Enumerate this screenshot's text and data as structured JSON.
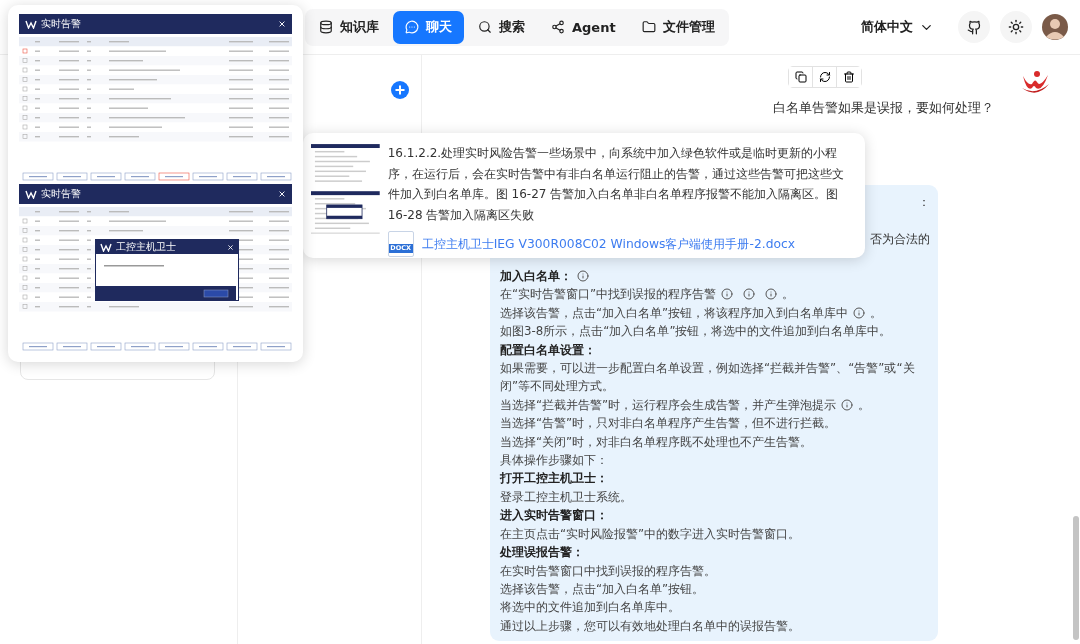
{
  "nav": {
    "tabs": [
      {
        "label": "知识库",
        "selected": false
      },
      {
        "label": "聊天",
        "selected": true
      },
      {
        "label": "搜索",
        "selected": false
      },
      {
        "label": "Agent",
        "selected": false
      },
      {
        "label": "文件管理",
        "selected": false
      }
    ],
    "language": "简体中文"
  },
  "preview": {
    "screens": [
      {
        "title": "实时告警"
      },
      {
        "title": "实时告警",
        "dialog": {
          "title": "工控主机卫士"
        }
      }
    ]
  },
  "chat": {
    "user_message": "白名单告警如果是误报，要如何处理？",
    "answer": {
      "fragments": [
        "：",
        "否为合法的"
      ],
      "lines": [
        {
          "bold": true,
          "segments": [
            {
              "kind": "text",
              "text": "加入白名单："
            },
            {
              "kind": "info"
            }
          ]
        },
        {
          "bold": false,
          "segments": [
            {
              "kind": "text",
              "text": "在“实时告警窗口”中找到误报的程序告警"
            },
            {
              "kind": "info"
            },
            {
              "kind": "info"
            },
            {
              "kind": "info"
            },
            {
              "kind": "text",
              "text": "。"
            }
          ]
        },
        {
          "bold": false,
          "segments": [
            {
              "kind": "text",
              "text": "选择该告警，点击“加入白名单”按钮，将该程序加入到白名单库中"
            },
            {
              "kind": "info"
            },
            {
              "kind": "text",
              "text": "。"
            }
          ]
        },
        {
          "bold": false,
          "text": "如图3-8所示，点击“加入白名单”按钮，将选中的文件追加到白名单库中。"
        },
        {
          "bold": true,
          "text": "配置白名单设置："
        },
        {
          "bold": false,
          "text": "如果需要，可以进一步配置白名单设置，例如选择“拦截并告警”、“告警”或“关闭”等不同处理方式。"
        },
        {
          "bold": false,
          "segments": [
            {
              "kind": "text",
              "text": "当选择“拦截并告警”时，运行程序会生成告警，并产生弹泡提示"
            },
            {
              "kind": "info"
            },
            {
              "kind": "text",
              "text": "。"
            }
          ]
        },
        {
          "bold": false,
          "text": "当选择“告警”时，只对非白名单程序产生告警，但不进行拦截。"
        },
        {
          "bold": false,
          "text": "当选择“关闭”时，对非白名单程序既不处理也不产生告警。"
        },
        {
          "bold": false,
          "text": "具体操作步骤如下："
        },
        {
          "bold": true,
          "text": "打开工控主机卫士："
        },
        {
          "bold": false,
          "text": "登录工控主机卫士系统。"
        },
        {
          "bold": true,
          "text": "进入实时告警窗口："
        },
        {
          "bold": false,
          "text": "在主页点击“实时风险报警”中的数字进入实时告警窗口。"
        },
        {
          "bold": true,
          "text": "处理误报告警："
        },
        {
          "bold": false,
          "text": "在实时告警窗口中找到误报的程序告警。"
        },
        {
          "bold": false,
          "text": "选择该告警，点击“加入白名单”按钮。"
        },
        {
          "bold": false,
          "text": "将选中的文件追加到白名单库中。"
        },
        {
          "bold": false,
          "text": "通过以上步骤，您可以有效地处理白名单中的误报告警。"
        }
      ]
    }
  },
  "source_popup": {
    "text": "16.1.2.2.处理实时风险告警一些场景中，向系统中加入绿色软件或是临时更新的小程序，在运行后，会在实时告警中有非白名单运行阻止的告警，通过这些告警可把这些文件加入到白名单库。图 16-27 告警加入白名单非白名单程序报警不能加入隔离区。图 16-28 告警加入隔离区失败",
    "file_type": "DOCX",
    "file": "工控主机卫士IEG V300R008C02 Windows客户端使用手册-2.docx"
  }
}
